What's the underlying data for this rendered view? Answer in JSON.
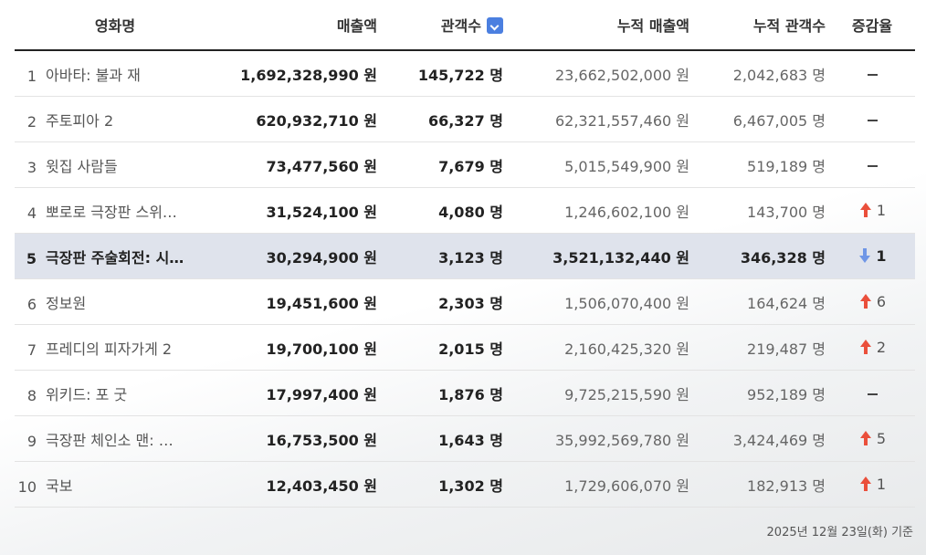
{
  "headers": {
    "title": "영화명",
    "sales": "매출액",
    "audience": "관객수",
    "cum_sales": "누적 매출액",
    "cum_audience": "누적 관객수",
    "change": "증감율"
  },
  "rows": [
    {
      "rank": "1",
      "title": "아바타: 불과 재",
      "sales": "1,692,328,990 원",
      "audience": "145,722 명",
      "cum_sales": "23,662,502,000 원",
      "cum_audience": "2,042,683 명",
      "change_dir": "none",
      "change": ""
    },
    {
      "rank": "2",
      "title": "주토피아 2",
      "sales": "620,932,710 원",
      "audience": "66,327 명",
      "cum_sales": "62,321,557,460 원",
      "cum_audience": "6,467,005 명",
      "change_dir": "none",
      "change": ""
    },
    {
      "rank": "3",
      "title": "윗집 사람들",
      "sales": "73,477,560 원",
      "audience": "7,679 명",
      "cum_sales": "5,015,549,900 원",
      "cum_audience": "519,189 명",
      "change_dir": "none",
      "change": ""
    },
    {
      "rank": "4",
      "title": "뽀로로 극장판 스위…",
      "sales": "31,524,100 원",
      "audience": "4,080 명",
      "cum_sales": "1,246,602,100 원",
      "cum_audience": "143,700 명",
      "change_dir": "up",
      "change": "1"
    },
    {
      "rank": "5",
      "title": "극장판 주술회전: 시…",
      "sales": "30,294,900 원",
      "audience": "3,123 명",
      "cum_sales": "3,521,132,440 원",
      "cum_audience": "346,328 명",
      "change_dir": "down",
      "change": "1"
    },
    {
      "rank": "6",
      "title": "정보원",
      "sales": "19,451,600 원",
      "audience": "2,303 명",
      "cum_sales": "1,506,070,400 원",
      "cum_audience": "164,624 명",
      "change_dir": "up",
      "change": "6"
    },
    {
      "rank": "7",
      "title": "프레디의 피자가게 2",
      "sales": "19,700,100 원",
      "audience": "2,015 명",
      "cum_sales": "2,160,425,320 원",
      "cum_audience": "219,487 명",
      "change_dir": "up",
      "change": "2"
    },
    {
      "rank": "8",
      "title": "위키드: 포 굿",
      "sales": "17,997,400 원",
      "audience": "1,876 명",
      "cum_sales": "9,725,215,590 원",
      "cum_audience": "952,189 명",
      "change_dir": "none",
      "change": ""
    },
    {
      "rank": "9",
      "title": "극장판 체인소 맨: …",
      "sales": "16,753,500 원",
      "audience": "1,643 명",
      "cum_sales": "35,992,569,780 원",
      "cum_audience": "3,424,469 명",
      "change_dir": "up",
      "change": "5"
    },
    {
      "rank": "10",
      "title": "국보",
      "sales": "12,403,450 원",
      "audience": "1,302 명",
      "cum_sales": "1,729,606,070 원",
      "cum_audience": "182,913 명",
      "change_dir": "up",
      "change": "1"
    }
  ],
  "highlight_rank": "5",
  "footnote": "2025년 12월 23일(화) 기준",
  "colors": {
    "up": "#ea4f3b",
    "down": "#6f96e6",
    "sort_accent": "#4b7fe0",
    "highlight_row": "#dfe3ec"
  }
}
